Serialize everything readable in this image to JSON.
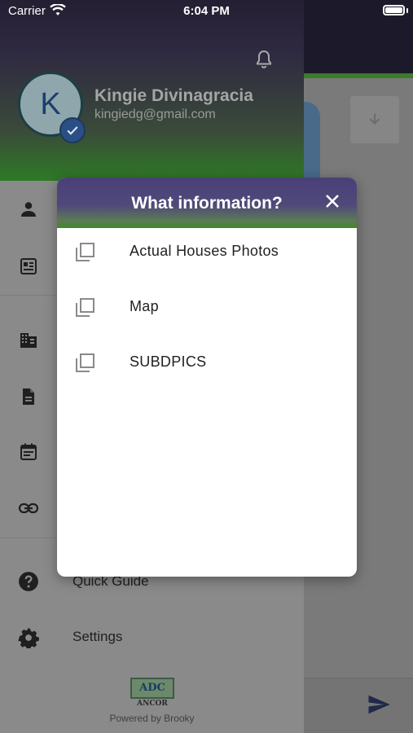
{
  "status_bar": {
    "carrier": "Carrier",
    "time": "6:04 PM"
  },
  "user": {
    "avatar_initial": "K",
    "name": "Kingie Divinagracia",
    "email": "kingiedg@gmail.com"
  },
  "drawer": {
    "icons": [
      "person-icon",
      "id-card-icon",
      "building-icon",
      "document-icon",
      "calendar-icon",
      "link-icon"
    ],
    "items": [
      {
        "label": "Quick Guide",
        "icon": "help-icon"
      },
      {
        "label": "Settings",
        "icon": "gear-icon"
      }
    ],
    "logo_text": "ADC",
    "logo_subtext": "ANCOR",
    "powered_by": "Powered by Brooky"
  },
  "dialog": {
    "title": "What information?",
    "options": [
      {
        "label": "Actual Houses Photos",
        "checked": false
      },
      {
        "label": "Map",
        "checked": false
      },
      {
        "label": "SUBDPICS",
        "checked": false
      }
    ]
  },
  "colors": {
    "brand_purple": "#4a3f78",
    "brand_green": "#3f8a2a",
    "verified_blue": "#2a4f86"
  }
}
